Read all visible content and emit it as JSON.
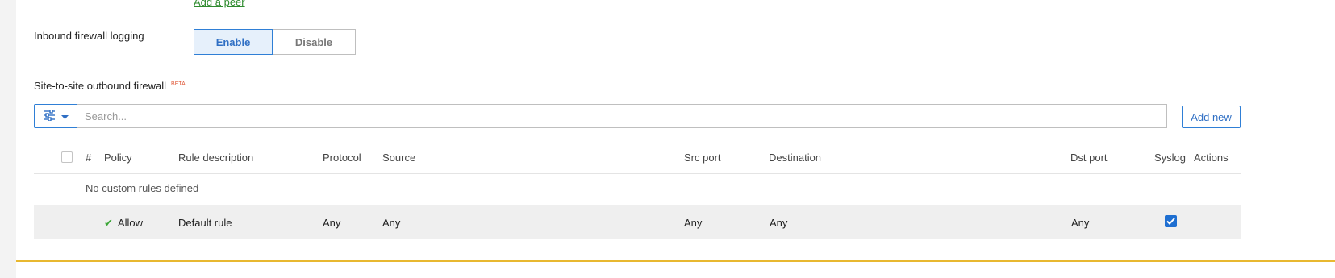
{
  "peer": {
    "add_link": "Add a peer"
  },
  "logging": {
    "label": "Inbound firewall logging",
    "enable_label": "Enable",
    "disable_label": "Disable",
    "selected": "Enable"
  },
  "outbound": {
    "title": "Site-to-site outbound firewall",
    "badge": "BETA",
    "search_placeholder": "Search...",
    "add_new_label": "Add new"
  },
  "table": {
    "headers": {
      "num": "#",
      "policy": "Policy",
      "description": "Rule description",
      "protocol": "Protocol",
      "source": "Source",
      "src_port": "Src port",
      "destination": "Destination",
      "dst_port": "Dst port",
      "syslog": "Syslog",
      "actions": "Actions"
    },
    "empty_message": "No custom rules defined",
    "default_rule": {
      "policy": "Allow",
      "description": "Default rule",
      "protocol": "Any",
      "source": "Any",
      "src_port": "Any",
      "destination": "Any",
      "dst_port": "Any",
      "syslog_checked": true
    }
  },
  "colors": {
    "accent": "#2f7fd6",
    "link_green": "#2e8b2e",
    "allow_green": "#3aa535",
    "beta_red": "#e05a3a",
    "bottom_rule": "#e8b830"
  },
  "icons": {
    "filter": "sliders-icon",
    "dropdown": "caret-down-icon",
    "allow": "check-icon",
    "syslog": "checkbox-checked-icon"
  }
}
